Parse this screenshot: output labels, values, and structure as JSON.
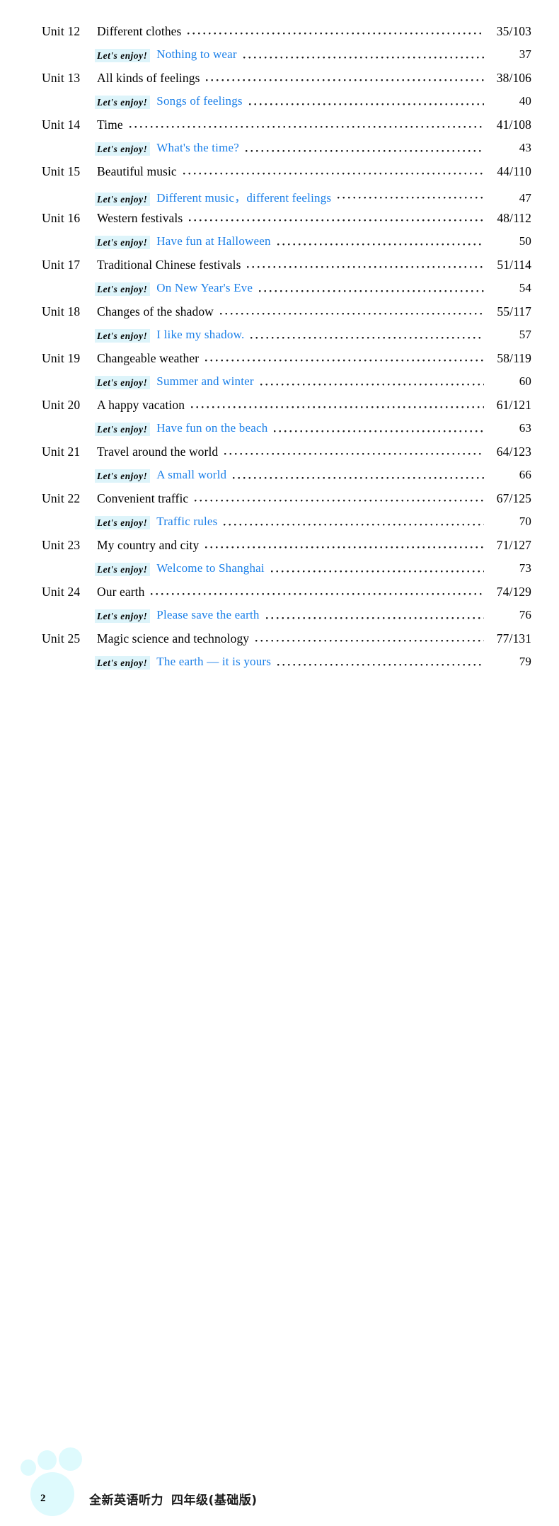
{
  "document": {
    "type": "table-of-contents",
    "accent_blue": "#1a7fe8",
    "highlight_bg": "#ddf4fa",
    "paw_color": "#defafd"
  },
  "toc": {
    "enjoy_tag": "Let's enjoy!",
    "entries": [
      {
        "unit": "Unit 12",
        "title": "Different clothes",
        "page": "35/103",
        "enjoy_title": "Nothing to wear",
        "enjoy_page": "37"
      },
      {
        "unit": "Unit 13",
        "title": "All kinds of feelings",
        "page": "38/106",
        "enjoy_title": "Songs of feelings",
        "enjoy_page": "40"
      },
      {
        "unit": "Unit 14",
        "title": "Time",
        "page": "41/108",
        "enjoy_title": "What's the time?",
        "enjoy_page": "43"
      },
      {
        "unit": "Unit 15",
        "title": "Beautiful music",
        "page": "44/110",
        "enjoy_title": "Different music，different feelings",
        "enjoy_page": "47"
      },
      {
        "unit": "Unit 16",
        "title": "Western festivals",
        "page": "48/112",
        "enjoy_title": "Have fun at Halloween",
        "enjoy_page": "50"
      },
      {
        "unit": "Unit 17",
        "title": "Traditional Chinese festivals",
        "page": "51/114",
        "enjoy_title": "On New Year's Eve",
        "enjoy_page": "54"
      },
      {
        "unit": "Unit 18",
        "title": "Changes of the shadow",
        "page": "55/117",
        "enjoy_title": "I like my shadow.",
        "enjoy_page": "57"
      },
      {
        "unit": "Unit 19",
        "title": "Changeable weather",
        "page": "58/119",
        "enjoy_title": "Summer and winter",
        "enjoy_page": "60"
      },
      {
        "unit": "Unit 20",
        "title": "A happy vacation",
        "page": "61/121",
        "enjoy_title": "Have fun on the beach",
        "enjoy_page": "63"
      },
      {
        "unit": "Unit 21",
        "title": "Travel around the world",
        "page": "64/123",
        "enjoy_title": "A small world",
        "enjoy_page": "66"
      },
      {
        "unit": "Unit 22",
        "title": "Convenient traffic",
        "page": "67/125",
        "enjoy_title": "Traffic rules",
        "enjoy_page": "70"
      },
      {
        "unit": "Unit 23",
        "title": "My country and city",
        "page": "71/127",
        "enjoy_title": "Welcome to Shanghai",
        "enjoy_page": "73"
      },
      {
        "unit": "Unit 24",
        "title": "Our earth",
        "page": "74/129",
        "enjoy_title": "Please save the earth",
        "enjoy_page": "76"
      },
      {
        "unit": "Unit 25",
        "title": "Magic science and technology",
        "page": "77/131",
        "enjoy_title": "The earth — it is yours",
        "enjoy_page": "79"
      }
    ]
  },
  "footer": {
    "folio": "2",
    "book_title": "全新英语听力",
    "grade": "四年级(基础版)"
  }
}
